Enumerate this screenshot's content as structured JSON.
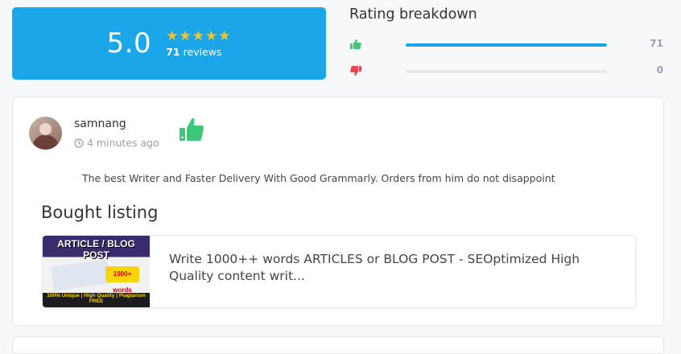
{
  "summary": {
    "score": "5.0",
    "stars": "★★★★★",
    "review_count": "71",
    "review_word": "reviews"
  },
  "breakdown": {
    "title": "Rating breakdown",
    "positive": {
      "count": "71",
      "fraction": 1.0
    },
    "negative": {
      "count": "0",
      "fraction": 0.0
    }
  },
  "review": {
    "reviewer": "samnang",
    "time": "4 minutes ago",
    "text": "The best Writer and Faster Delivery With Good Grammarly. Orders from him do not disappoint",
    "bought_title": "Bought listing",
    "listing": {
      "title": "Write 1000++ words ARTICLES or BLOG POST - SEOptimized High Quality content writ...",
      "image_text": "ARTICLE / BLOG POST",
      "image_badge": "1000+ words",
      "image_footer": "100% Unique | High Quality | Plagiarism FREE"
    }
  },
  "colors": {
    "accent": "#1aa6e8",
    "star": "#f7c62f",
    "positive": "#3cc77b",
    "negative": "#e8494f"
  }
}
